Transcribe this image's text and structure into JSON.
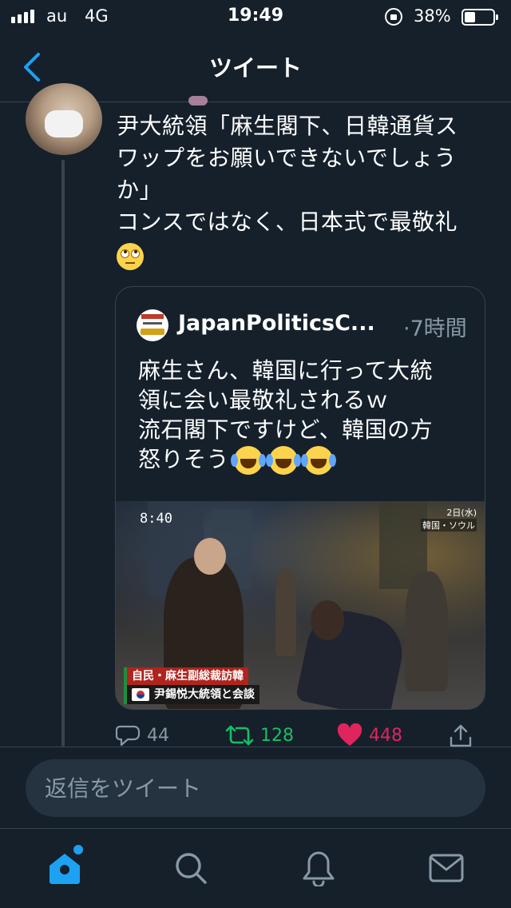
{
  "status_bar": {
    "carrier": "au",
    "network": "4G",
    "time": "19:49",
    "battery": "38%",
    "battery_level": 0.38
  },
  "nav": {
    "title": "ツイート",
    "back_icon": "chevron-left-icon"
  },
  "tweet": {
    "lines": [
      "尹大統領「麻生閣下、日韓通貨ス",
      "ワップをお願いできないでしょう",
      "か」",
      "コンスではなく、日本式で最敬礼"
    ],
    "emoji": "eye-roll-emoji",
    "actions": {
      "reply_count": "44",
      "retweet_count": "128",
      "like_count": "448"
    }
  },
  "quote": {
    "author": "JapanPoliticsC...",
    "time": "·7時間",
    "lines": [
      "麻生さん、韓国に行って大統",
      "領に会い最敬礼されるｗ",
      "流石閣下ですけど、韓国の方",
      "怒りそう"
    ],
    "emoji_count": 3,
    "media": {
      "timestamp": "8:40",
      "date": "2日(水)",
      "location": "韓国・ソウル",
      "caption_top": "自民・麻生副総裁訪韓",
      "caption_bottom": "尹錫悦大統領と会談"
    }
  },
  "reply_bar": {
    "placeholder": "返信をツイート"
  },
  "tab_bar": {
    "items": [
      "home-icon",
      "search-icon",
      "bell-icon",
      "mail-icon"
    ],
    "active": "home-icon"
  },
  "colors": {
    "background": "#15202b",
    "accent": "#1da1f2",
    "retweet": "#17bf63",
    "like": "#e0245e",
    "secondary_text": "#8899a6"
  }
}
